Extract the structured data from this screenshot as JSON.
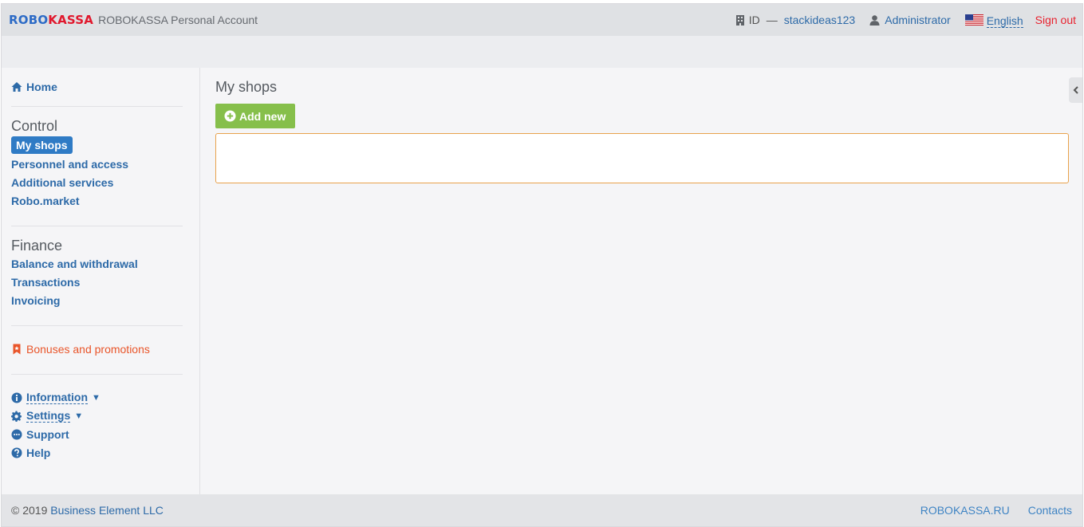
{
  "header": {
    "logo_robo": "ROBO",
    "logo_kassa": "KASSA",
    "title": "ROBOKASSA Personal Account",
    "id_label": "ID",
    "id_dash": "—",
    "id_value": "stackideas123",
    "user_role": "Administrator",
    "language": "English",
    "sign_out": "Sign out"
  },
  "sidebar": {
    "home": "Home",
    "control_heading": "Control",
    "control_items": {
      "my_shops": "My shops",
      "personnel": "Personnel and access",
      "additional": "Additional services",
      "robomarket": "Robo.market"
    },
    "finance_heading": "Finance",
    "finance_items": {
      "balance": "Balance and withdrawal",
      "transactions": "Transactions",
      "invoicing": "Invoicing"
    },
    "bonuses": "Bonuses and promotions",
    "information": "Information",
    "settings": "Settings",
    "support": "Support",
    "help": "Help"
  },
  "main": {
    "title": "My shops",
    "add_button": "Add new"
  },
  "footer": {
    "copyright": "© 2019",
    "company": "Business Element LLC",
    "site_link": "ROBOKASSA.RU",
    "contacts": "Contacts"
  },
  "colors": {
    "accent_blue": "#2f7bc5",
    "brand_red": "#e0182d",
    "add_green": "#86bf4b",
    "bonus_orange": "#e9552a",
    "box_border": "#e8a24c"
  }
}
